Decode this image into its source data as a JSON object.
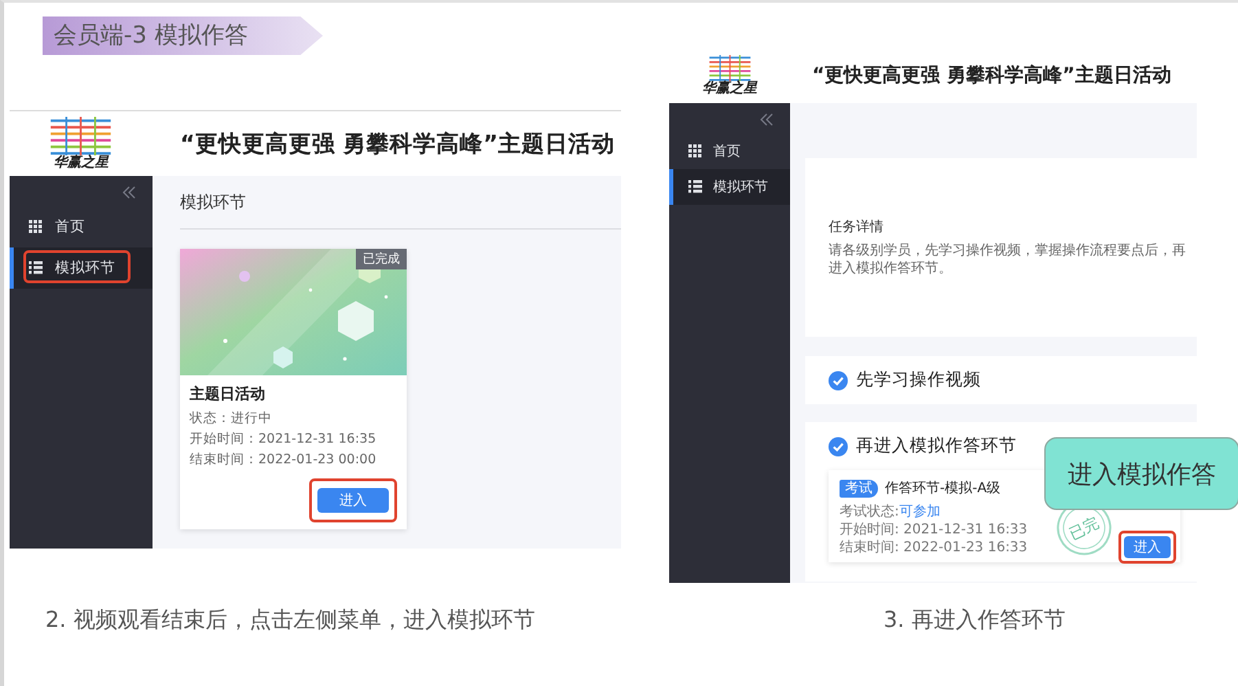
{
  "slide_title": "会员端-3  模拟作答",
  "left_screen": {
    "logo_text": "华赢之星",
    "title": "“更快更高更强 勇攀科学高峰”主题日活动",
    "menu": [
      {
        "label": "首页",
        "selected": false,
        "marked": false
      },
      {
        "label": "模拟环节",
        "selected": true,
        "marked": true
      }
    ],
    "page_heading": "模拟环节",
    "card": {
      "badge": "已完成",
      "title": "主题日活动",
      "lines": [
        "状态：进行中",
        "开始时间：2021-12-31 16:35",
        "结束时间：2022-01-23 00:00"
      ],
      "button": {
        "label": "进入",
        "marked": true
      }
    }
  },
  "right_screen": {
    "logo_text": "华赢之星",
    "title": "“更快更高更强 勇攀科学高峰”主题日活动",
    "menu": [
      {
        "label": "首页",
        "selected": false,
        "marked": false
      },
      {
        "label": "模拟环节",
        "selected": true,
        "marked": false
      }
    ],
    "task": {
      "heading": "任务详情",
      "text": "请各级别学员，先学习操作视频，掌握操作流程要点后，再进入模拟作答环节。"
    },
    "sections": [
      {
        "label": "先学习操作视频",
        "checked": true
      },
      {
        "label": "再进入模拟作答环节",
        "checked": true,
        "exam": {
          "tag": "考试",
          "title": "作答环节-模拟-A级",
          "status_label": "考试状态: ",
          "status_value": "可参加",
          "lines": [
            "开始时间: 2021-12-31 16:33",
            "结束时间: 2022-01-23 16:33"
          ],
          "stamp": "已完",
          "button": {
            "label": "进入",
            "marked": true
          }
        }
      }
    ]
  },
  "callout": "进入模拟作答",
  "captions": [
    "2. 视频观看结束后，点击左侧菜单，进入模拟环节",
    "3. 再进入作答环节"
  ]
}
